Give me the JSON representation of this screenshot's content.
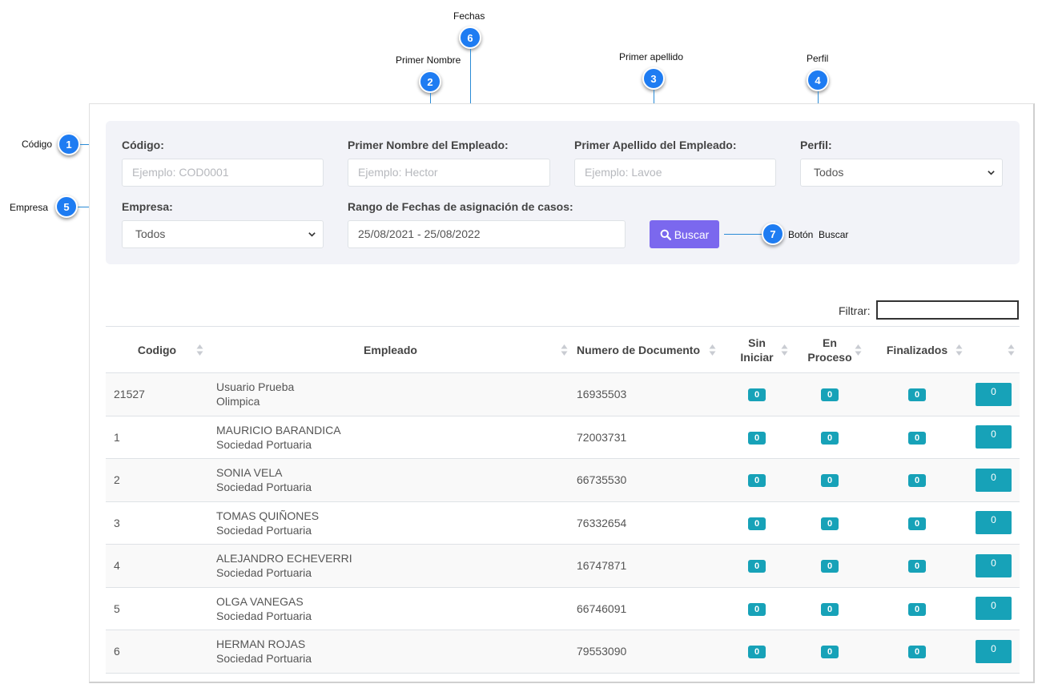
{
  "callouts": [
    {
      "n": "1",
      "label": "Código"
    },
    {
      "n": "2",
      "label": "Primer Nombre"
    },
    {
      "n": "3",
      "label": "Primer apellido"
    },
    {
      "n": "4",
      "label": "Perfil"
    },
    {
      "n": "5",
      "label": "Empresa"
    },
    {
      "n": "6",
      "label": "Fechas"
    },
    {
      "n": "7",
      "label": "Botón  Buscar"
    }
  ],
  "filters": {
    "codigo": {
      "label": "Código:",
      "placeholder": "Ejemplo: COD0001"
    },
    "nombre": {
      "label": "Primer Nombre del Empleado:",
      "placeholder": "Ejemplo: Hector"
    },
    "apellido": {
      "label": "Primer Apellido del Empleado:",
      "placeholder": "Ejemplo: Lavoe"
    },
    "perfil": {
      "label": "Perfil:",
      "value": "Todos"
    },
    "empresa": {
      "label": "Empresa:",
      "value": "Todos"
    },
    "fechas": {
      "label": "Rango de Fechas de asignación de casos:",
      "value": "25/08/2021 - 25/08/2022"
    },
    "buscar_label": "Buscar"
  },
  "table": {
    "filter_label": "Filtrar:",
    "columns": [
      "Codigo",
      "Empleado",
      "Numero de Documento",
      "Sin Iniciar",
      "En Proceso",
      "Finalizados",
      ""
    ],
    "rows": [
      {
        "codigo": "21527",
        "nombre": "Usuario Prueba",
        "empresa": "Olimpica",
        "documento": "16935503",
        "sin_iniciar": "0",
        "en_proceso": "0",
        "finalizados": "0",
        "total": "0"
      },
      {
        "codigo": "1",
        "nombre": "MAURICIO BARANDICA",
        "empresa": "Sociedad Portuaria",
        "documento": "72003731",
        "sin_iniciar": "0",
        "en_proceso": "0",
        "finalizados": "0",
        "total": "0"
      },
      {
        "codigo": "2",
        "nombre": "SONIA VELA",
        "empresa": "Sociedad Portuaria",
        "documento": "66735530",
        "sin_iniciar": "0",
        "en_proceso": "0",
        "finalizados": "0",
        "total": "0"
      },
      {
        "codigo": "3",
        "nombre": "TOMAS QUIÑONES",
        "empresa": "Sociedad Portuaria",
        "documento": "76332654",
        "sin_iniciar": "0",
        "en_proceso": "0",
        "finalizados": "0",
        "total": "0"
      },
      {
        "codigo": "4",
        "nombre": "ALEJANDRO ECHEVERRI",
        "empresa": "Sociedad Portuaria",
        "documento": "16747871",
        "sin_iniciar": "0",
        "en_proceso": "0",
        "finalizados": "0",
        "total": "0"
      },
      {
        "codigo": "5",
        "nombre": "OLGA VANEGAS",
        "empresa": "Sociedad Portuaria",
        "documento": "66746091",
        "sin_iniciar": "0",
        "en_proceso": "0",
        "finalizados": "0",
        "total": "0"
      },
      {
        "codigo": "6",
        "nombre": "HERMAN ROJAS",
        "empresa": "Sociedad Portuaria",
        "documento": "79553090",
        "sin_iniciar": "0",
        "en_proceso": "0",
        "finalizados": "0",
        "total": "0"
      }
    ]
  },
  "colors": {
    "callout": "#1e7cf2",
    "buscar": "#7b68ee",
    "counter": "#17a2b8",
    "filter_bg": "#f2f3f8"
  }
}
